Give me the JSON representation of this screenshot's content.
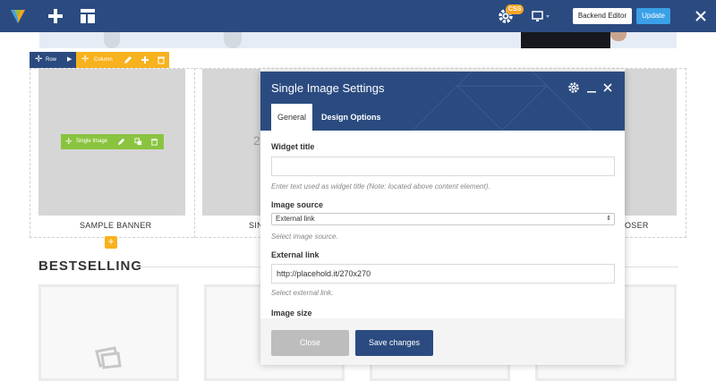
{
  "toolbar": {
    "css_badge": "CSS",
    "backend_editor_label": "Backend Editor",
    "update_label": "Update",
    "icons": [
      "visual-composer-logo-icon",
      "add-element-icon",
      "templates-layout-icon",
      "settings-gear-icon",
      "responsive-device-icon",
      "close-icon"
    ]
  },
  "builder": {
    "row_label": "Row",
    "column_label": "Column",
    "single_image_label": "Single Image",
    "banners": [
      "SAMPLE BANNER",
      "SIN",
      "OSER"
    ],
    "banner_placeholder_text": "27"
  },
  "bestselling": {
    "title": "BESTSELLING"
  },
  "modal": {
    "title": "Single Image Settings",
    "tabs": [
      {
        "label": "General"
      },
      {
        "label": "Design Options"
      }
    ],
    "fields": {
      "widget_title": {
        "label": "Widget title",
        "value": "",
        "help": "Enter text used as widget title (Note: located above content element)."
      },
      "image_source": {
        "label": "Image source",
        "value": "External link",
        "help": "Select image source."
      },
      "external_link": {
        "label": "External link",
        "value": "http://placehold.it/270x270",
        "help": "Select external link."
      },
      "image_size": {
        "label": "Image size"
      }
    },
    "close_label": "Close",
    "save_label": "Save changes"
  },
  "colors": {
    "primary": "#2b4b80",
    "accent_blue": "#3aa0e8",
    "column_orange": "#f7b21e",
    "element_green": "#8ac43f"
  }
}
